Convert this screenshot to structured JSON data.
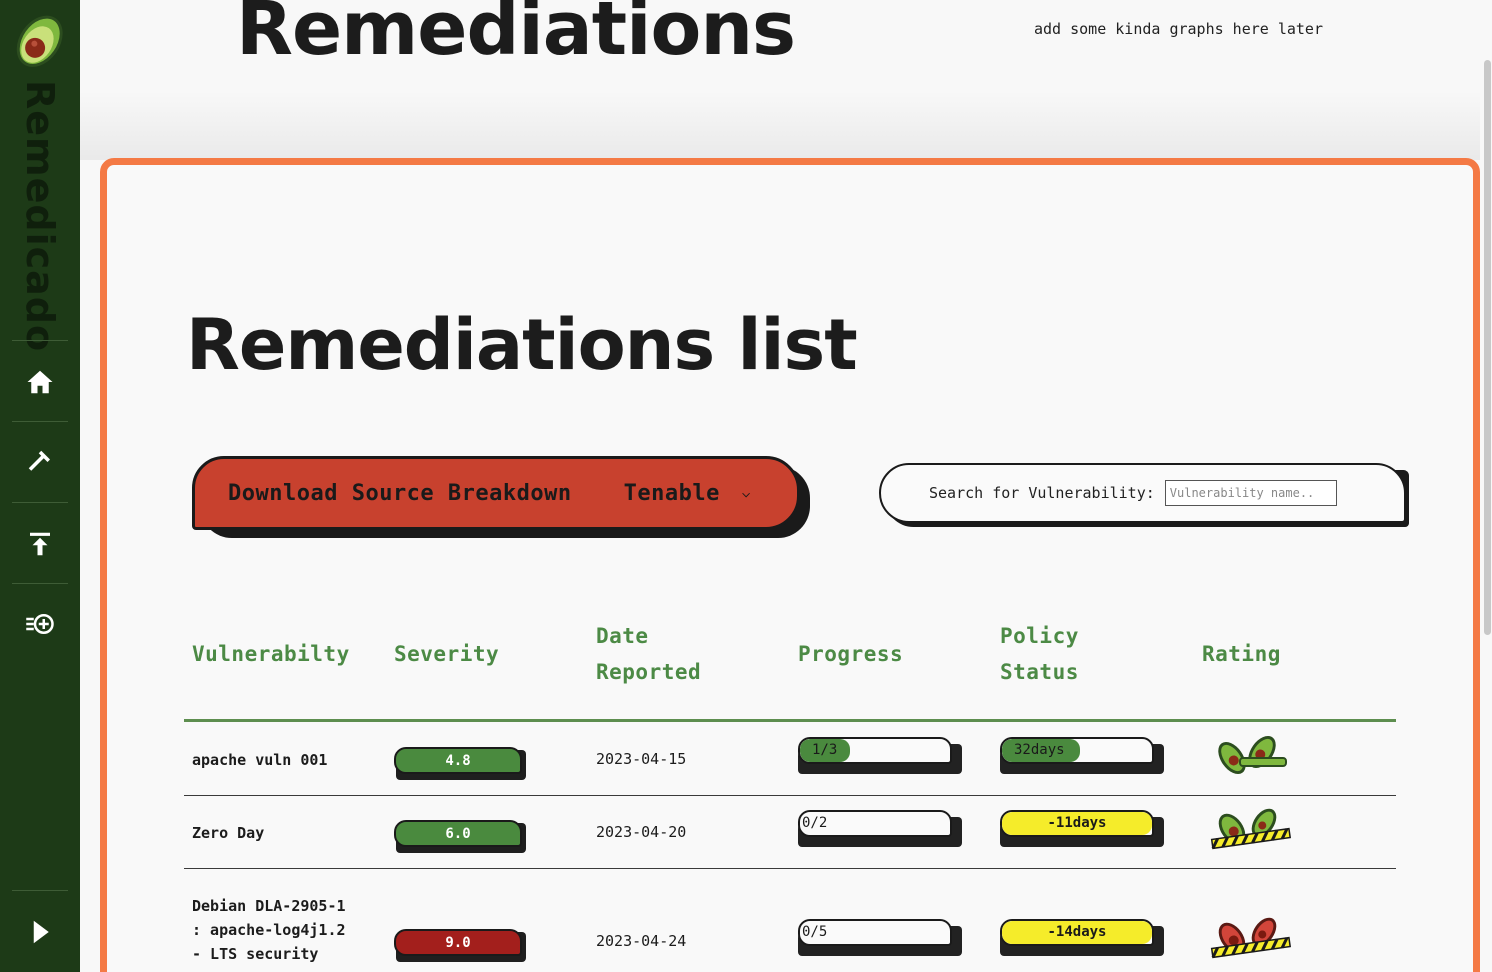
{
  "app": {
    "brand": "Remedicado"
  },
  "header": {
    "title": "Remediations",
    "note": "add some kinda graphs here later"
  },
  "sidebar": {
    "items": [
      {
        "icon": "home-icon"
      },
      {
        "icon": "hammer-icon"
      },
      {
        "icon": "upload-icon"
      },
      {
        "icon": "add-entry-icon"
      }
    ],
    "expand_icon": "play-arrow-icon"
  },
  "main": {
    "title": "Remediations list",
    "download": {
      "label": "Download Source Breakdown",
      "selected": "Tenable"
    },
    "search": {
      "label": "Search for Vulnerability:",
      "placeholder": "Vulnerability name.."
    },
    "table": {
      "headers": [
        "Vulnerabilty",
        "Severity",
        "Date Reported",
        "Progress",
        "Policy Status",
        "Rating"
      ],
      "rows": [
        {
          "vulnerability": "apache vuln 001",
          "severity": "4.8",
          "severity_color": "#4a8a3e",
          "date": "2023-04-15",
          "progress": "1/3",
          "progress_fraction": 0.333,
          "policy": "32days",
          "policy_fraction": 0.52,
          "policy_color": "#4a8a3e",
          "rating": "green"
        },
        {
          "vulnerability": "Zero Day",
          "severity": "6.0",
          "severity_color": "#4a8a3e",
          "date": "2023-04-20",
          "progress": "0/2",
          "progress_fraction": 0,
          "policy": "-11days",
          "policy_fraction": 1,
          "policy_color": "#f5ec2a",
          "rating": "yellow-tape"
        },
        {
          "vulnerability": "Debian DLA-2905-1 : apache-log4j1.2 - LTS security",
          "vulnerability_lines": [
            "Debian DLA-2905-1",
            ": apache-log4j1.2",
            "- LTS security"
          ],
          "severity": "9.0",
          "severity_color": "#a31f1c",
          "date": "2023-04-24",
          "progress": "0/5",
          "progress_fraction": 0,
          "policy": "-14days",
          "policy_fraction": 1,
          "policy_color": "#f5ec2a",
          "rating": "red-tape"
        }
      ]
    }
  }
}
